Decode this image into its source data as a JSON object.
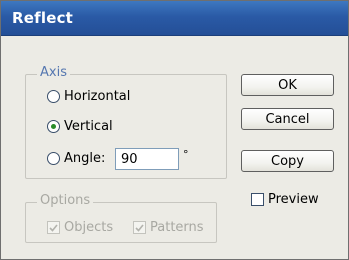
{
  "window": {
    "title": "Reflect"
  },
  "axis": {
    "legend": "Axis",
    "horizontal_label": "Horizontal",
    "vertical_label": "Vertical",
    "angle_label": "Angle:",
    "angle_value": "90",
    "degree_symbol": "°",
    "selected": "Vertical"
  },
  "options": {
    "legend": "Options",
    "objects_label": "Objects",
    "patterns_label": "Patterns",
    "objects_checked": true,
    "patterns_checked": true,
    "enabled": false
  },
  "buttons": {
    "ok": "OK",
    "cancel": "Cancel",
    "copy": "Copy"
  },
  "preview": {
    "label": "Preview",
    "checked": false
  },
  "colors": {
    "titlebar": "#2a5aa6",
    "dialog_bg": "#ecebe5",
    "legend_text": "#5577b0",
    "radio_selected": "#2a8c2a"
  }
}
